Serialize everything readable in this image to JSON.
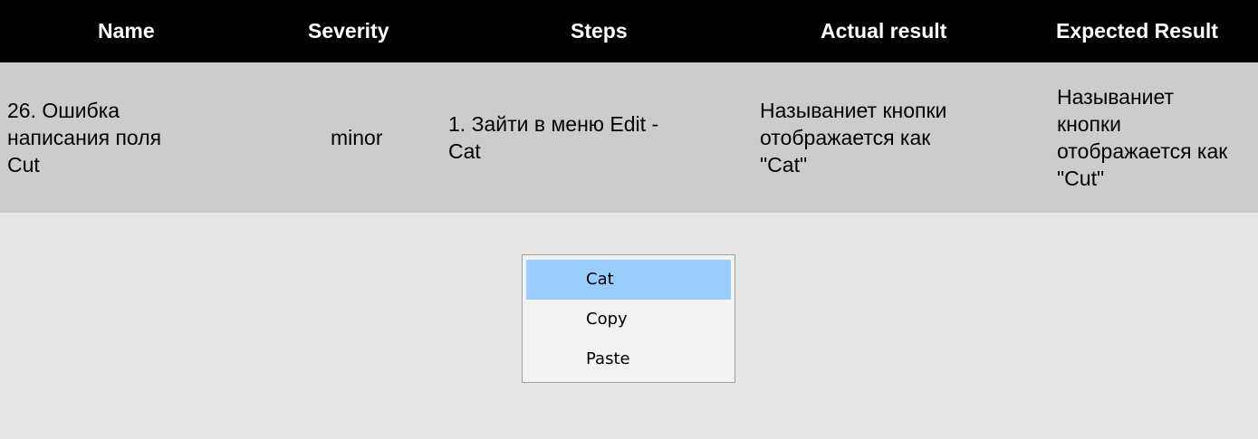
{
  "table": {
    "headers": {
      "name": "Name",
      "severity": "Severity",
      "steps": "Steps",
      "actual": "Actual result",
      "expected": "Expected Result"
    },
    "row": {
      "name": "26. Ошибка\nнаписания поля\nCut",
      "severity": "minor",
      "steps": "1. Зайти в меню Edit -\nCat",
      "actual": "Называниет кнопки\nотображается как\n\"Cat\"",
      "expected": "Называниет\nкнопки\nотображается как\n\"Cut\""
    }
  },
  "context_menu": {
    "items": [
      "Cat",
      "Copy",
      "Paste"
    ],
    "selected_index": 0
  },
  "colors": {
    "header_bg": "#000000",
    "row_bg": "#cccccc",
    "screenshot_bg": "#e6e6e6",
    "menu_highlight": "#99ccff"
  }
}
